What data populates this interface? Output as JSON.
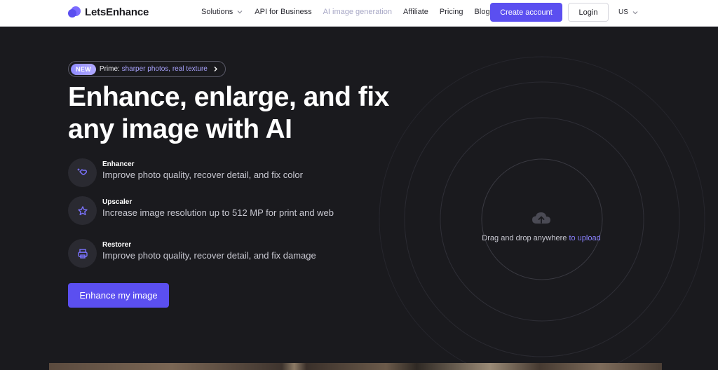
{
  "header": {
    "logo_text": "LetsEnhance",
    "nav": [
      {
        "label": "Solutions",
        "has_dropdown": true
      },
      {
        "label": "API for Business"
      },
      {
        "label": "AI image generation",
        "muted": true
      },
      {
        "label": "Affiliate"
      },
      {
        "label": "Pricing"
      },
      {
        "label": "Blog"
      }
    ],
    "create_account": "Create account",
    "login": "Login",
    "locale": "US"
  },
  "hero": {
    "badge": "NEW",
    "pill_prefix": "Prime: ",
    "pill_highlight": "sharper photos, real texture",
    "title": "Enhance, enlarge, and fix any image with AI",
    "features": [
      {
        "title": "Enhancer",
        "desc": "Improve photo quality, recover detail, and fix color",
        "icon": "hand-sparkle-icon"
      },
      {
        "title": "Upscaler",
        "desc": "Increase image resolution up to 512 MP for print and web",
        "icon": "star-expand-icon"
      },
      {
        "title": "Restorer",
        "desc": "Improve photo quality, recover detail, and fix damage",
        "icon": "printer-icon"
      }
    ],
    "cta": "Enhance my image"
  },
  "upload": {
    "text": "Drag and drop anywhere ",
    "link": "to upload",
    "icon": "cloud-upload-icon"
  },
  "colors": {
    "accent": "#5b4ff0",
    "background": "#1a1a1e",
    "link": "#8a82ff"
  }
}
